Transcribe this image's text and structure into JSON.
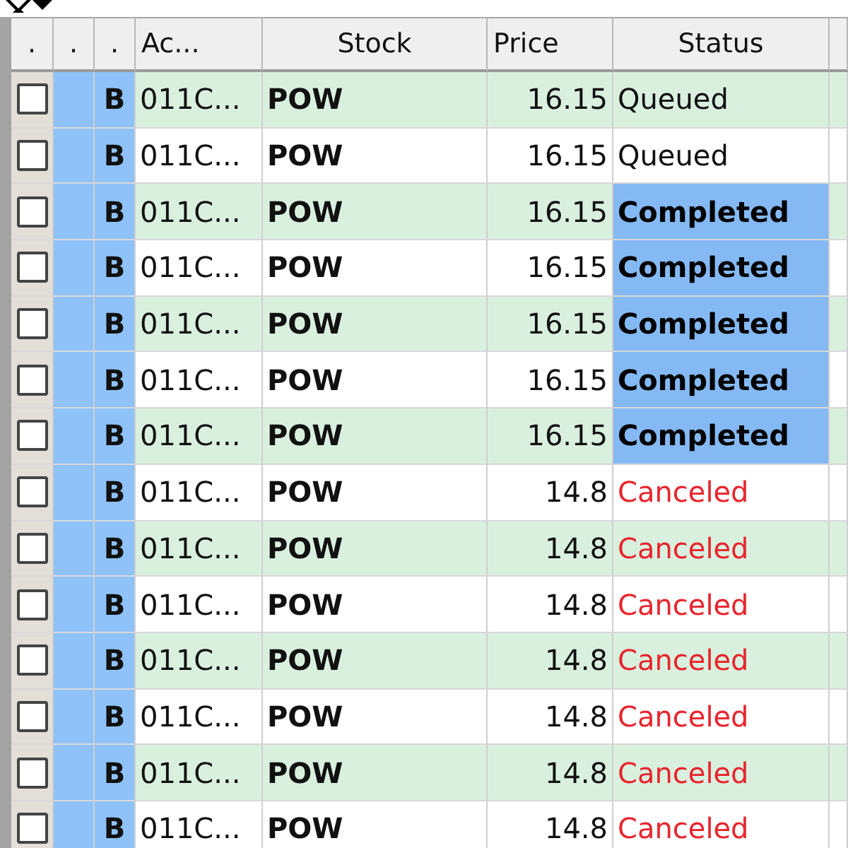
{
  "table": {
    "columns": [
      ".",
      ".",
      ".",
      "Ac...",
      "Stock",
      "Price",
      "Status"
    ],
    "rows": [
      {
        "checked": false,
        "side": "B",
        "account": "011C...",
        "stock": "POW",
        "price": "16.15",
        "status": "Queued",
        "kind": "queued"
      },
      {
        "checked": false,
        "side": "B",
        "account": "011C...",
        "stock": "POW",
        "price": "16.15",
        "status": "Queued",
        "kind": "queued"
      },
      {
        "checked": false,
        "side": "B",
        "account": "011C...",
        "stock": "POW",
        "price": "16.15",
        "status": "Completed",
        "kind": "completed"
      },
      {
        "checked": false,
        "side": "B",
        "account": "011C...",
        "stock": "POW",
        "price": "16.15",
        "status": "Completed",
        "kind": "completed"
      },
      {
        "checked": false,
        "side": "B",
        "account": "011C...",
        "stock": "POW",
        "price": "16.15",
        "status": "Completed",
        "kind": "completed"
      },
      {
        "checked": false,
        "side": "B",
        "account": "011C...",
        "stock": "POW",
        "price": "16.15",
        "status": "Completed",
        "kind": "completed"
      },
      {
        "checked": false,
        "side": "B",
        "account": "011C...",
        "stock": "POW",
        "price": "16.15",
        "status": "Completed",
        "kind": "completed"
      },
      {
        "checked": false,
        "side": "B",
        "account": "011C...",
        "stock": "POW",
        "price": "14.8",
        "status": "Canceled",
        "kind": "canceled"
      },
      {
        "checked": false,
        "side": "B",
        "account": "011C...",
        "stock": "POW",
        "price": "14.8",
        "status": "Canceled",
        "kind": "canceled"
      },
      {
        "checked": false,
        "side": "B",
        "account": "011C...",
        "stock": "POW",
        "price": "14.8",
        "status": "Canceled",
        "kind": "canceled"
      },
      {
        "checked": false,
        "side": "B",
        "account": "011C...",
        "stock": "POW",
        "price": "14.8",
        "status": "Canceled",
        "kind": "canceled"
      },
      {
        "checked": false,
        "side": "B",
        "account": "011C...",
        "stock": "POW",
        "price": "14.8",
        "status": "Canceled",
        "kind": "canceled"
      },
      {
        "checked": false,
        "side": "B",
        "account": "011C...",
        "stock": "POW",
        "price": "14.8",
        "status": "Canceled",
        "kind": "canceled"
      },
      {
        "checked": false,
        "side": "B",
        "account": "011C...",
        "stock": "POW",
        "price": "14.8",
        "status": "Canceled",
        "kind": "canceled"
      }
    ]
  }
}
